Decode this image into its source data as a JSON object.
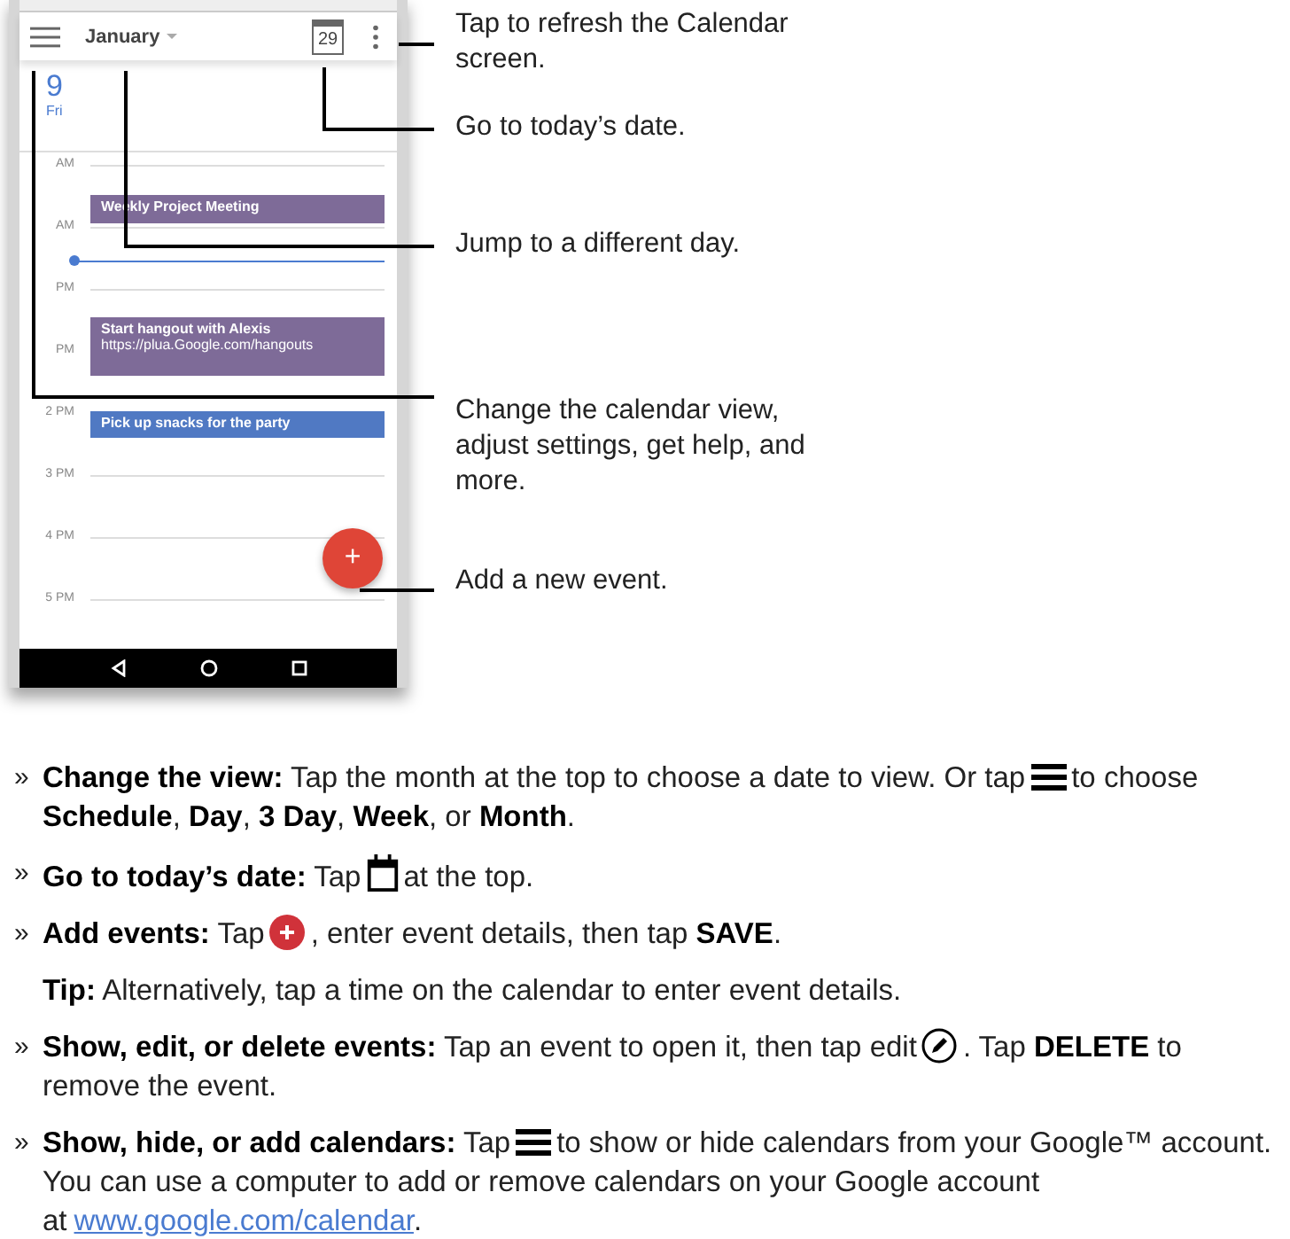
{
  "phone": {
    "app_bar": {
      "month": "January",
      "today_badge": "29"
    },
    "date_header": {
      "day": "9",
      "weekday": "Fri"
    },
    "hours": [
      "AM",
      "AM",
      "PM",
      "PM",
      "2 PM",
      "3 PM",
      "4 PM",
      "5 PM"
    ],
    "events": [
      {
        "title": "Weekly Project Meeting",
        "color": "#7e6b98"
      },
      {
        "title": "Start hangout with Alexis",
        "subtitle": "https://plua.Google.com/hangouts",
        "color": "#7e6b98"
      },
      {
        "title": "Pick up snacks for the party",
        "color": "#5079c3"
      }
    ],
    "fab": "+"
  },
  "callouts": [
    {
      "kind": "menu-more",
      "text": "Tap to refresh the Calendar screen."
    },
    {
      "kind": "today",
      "text": "Go to today’s date."
    },
    {
      "kind": "month",
      "text": "Jump to a different day."
    },
    {
      "kind": "menu",
      "text": "Change the calendar view, adjust settings, get help, and more."
    },
    {
      "kind": "fab",
      "text": "Add a new event."
    }
  ],
  "instructions": [
    {
      "marker": "»",
      "parts": [
        {
          "kind": "text",
          "text": "**Change the view:** Tap the month at the top to choose a date to view. Or tap"
        },
        {
          "kind": "menu"
        },
        {
          "kind": "text",
          "text": "to choose **Schedule**, **Day**, **3 Day**, **Week**, or **Month**."
        }
      ]
    },
    {
      "marker": "»",
      "parts": [
        {
          "kind": "text",
          "text": "**Go to today’s date:** Tap"
        },
        {
          "kind": "calendar"
        },
        {
          "kind": "text",
          "text": "at the top."
        }
      ]
    },
    {
      "marker": "»",
      "parts": [
        {
          "kind": "text",
          "text": "**Add events:** Tap"
        },
        {
          "kind": "add"
        },
        {
          "kind": "text",
          "text": ", enter event details, then tap **SAVE**."
        }
      ]
    },
    {
      "parts": [
        {
          "kind": "text",
          "text": "**Tip:** Alternatively, tap a time on the calendar to enter event details."
        }
      ]
    },
    {
      "marker": "»",
      "parts": [
        {
          "kind": "text",
          "text": "**Show, edit, or delete events:** Tap an event to open it, then tap edit"
        },
        {
          "kind": "edit"
        },
        {
          "kind": "text",
          "text": ". Tap **DELETE** to remove the event."
        }
      ]
    },
    {
      "marker": "»",
      "parts": [
        {
          "kind": "text",
          "text": "**Show, hide, or add calendars:** Tap"
        },
        {
          "kind": "menu"
        },
        {
          "kind": "text",
          "text": "to show or hide calendars from your Google™ account. You can use a computer to add or remove calendars on your Google account at"
        },
        {
          "kind": "link",
          "text": "www.google.com/calendar"
        },
        {
          "kind": "text",
          "text": "."
        }
      ]
    }
  ]
}
